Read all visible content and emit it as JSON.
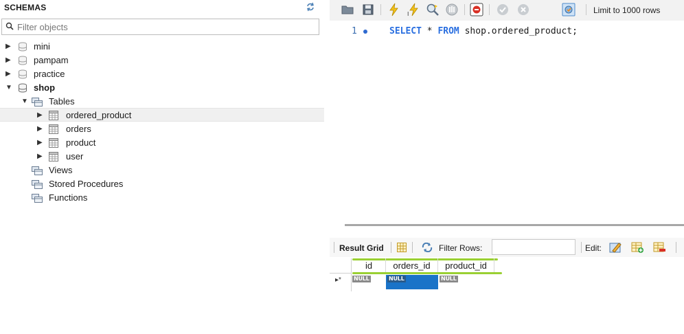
{
  "schemas": {
    "title": "SCHEMAS",
    "filter_placeholder": "Filter objects",
    "items": [
      {
        "label": "mini",
        "expanded": false
      },
      {
        "label": "pampam",
        "expanded": false
      },
      {
        "label": "practice",
        "expanded": false
      },
      {
        "label": "shop",
        "expanded": true,
        "bold": true
      }
    ],
    "shop_children": {
      "tables_label": "Tables",
      "tables": [
        "ordered_product",
        "orders",
        "product",
        "user"
      ],
      "views_label": "Views",
      "procedures_label": "Stored Procedures",
      "functions_label": "Functions"
    }
  },
  "toolbar": {
    "icons": [
      "open-folder-icon",
      "save-icon",
      "execute-icon",
      "execute-statement-icon",
      "explain-icon",
      "stop-icon",
      "toggle-error-icon",
      "commit-icon",
      "rollback-icon",
      "autocommit-icon"
    ],
    "limit_label": "Limit to 1000 rows"
  },
  "editor": {
    "line_number": "1",
    "sql_keyword_select": "SELECT",
    "sql_star": " * ",
    "sql_keyword_from": "FROM",
    "sql_rest": " shop.ordered_product;"
  },
  "result": {
    "result_grid_label": "Result Grid",
    "filter_rows_label": "Filter Rows:",
    "edit_label": "Edit:",
    "columns": [
      "id",
      "orders_id",
      "product_id"
    ],
    "null_label": "NULL",
    "new_row_marker": "▸*"
  },
  "colors": {
    "accent_blue": "#1a73c8",
    "highlight_green": "#9ad032",
    "keyword_blue": "#2a6fe0"
  }
}
